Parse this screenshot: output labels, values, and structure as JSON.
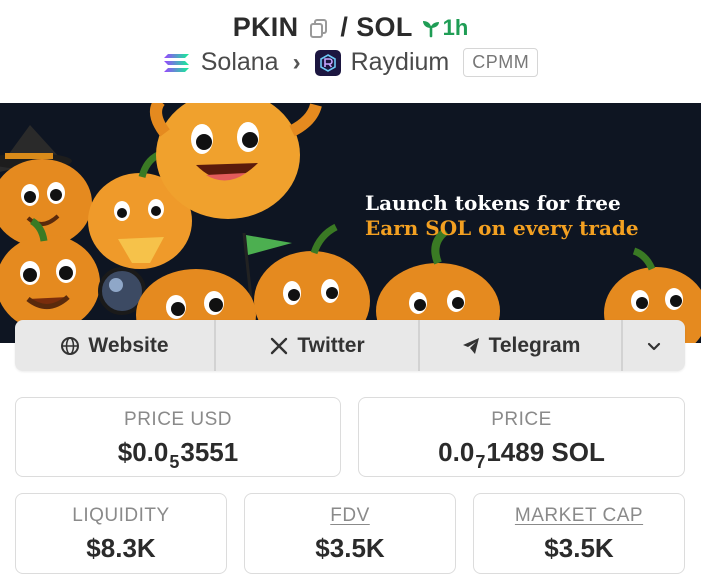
{
  "header": {
    "base_symbol": "PKIN",
    "separator": "/",
    "quote_symbol": "SOL",
    "age": "1h",
    "chain": "Solana",
    "dex": "Raydium",
    "pool_type": "CPMM"
  },
  "banner": {
    "line1": "Launch tokens for free",
    "line2": "Earn SOL on every trade"
  },
  "links": [
    {
      "label": "Website",
      "icon": "globe-icon"
    },
    {
      "label": "Twitter",
      "icon": "x-logo-icon"
    },
    {
      "label": "Telegram",
      "icon": "telegram-icon"
    },
    {
      "label": "",
      "icon": "chevron-down-icon"
    }
  ],
  "stats": {
    "price_usd": {
      "label": "PRICE USD",
      "prefix": "$0.0",
      "zeros": "5",
      "digits": "3551"
    },
    "price": {
      "label": "PRICE",
      "prefix": "0.0",
      "zeros": "7",
      "digits": "1489",
      "unit": " SOL"
    },
    "liquidity": {
      "label": "LIQUIDITY",
      "value": "$8.3K"
    },
    "fdv": {
      "label": "FDV",
      "value": "$3.5K"
    },
    "market_cap": {
      "label": "MARKET CAP",
      "value": "$3.5K"
    }
  },
  "colors": {
    "age_green": "#1f9d55",
    "banner_bg": "#0e1522",
    "banner_accent": "#f3a021"
  }
}
